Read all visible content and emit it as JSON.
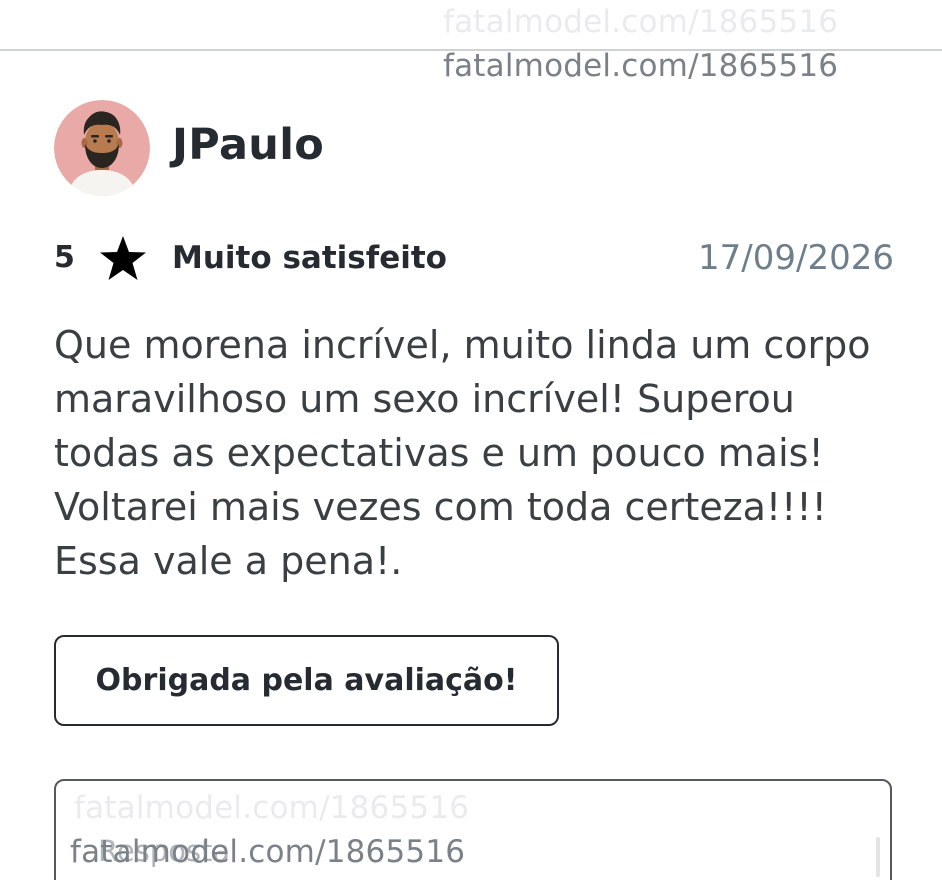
{
  "watermark": {
    "text": "fatalmodel.com/1865516"
  },
  "review": {
    "reviewer_name": "JPaulo",
    "avatar_icon": "bearded-man-avatar-icon",
    "rating": "5",
    "rating_icon": "star-icon",
    "rating_label": "Muito satisfeito",
    "date": "17/09/2026",
    "text": "Que morena incrível, muito linda um corpo maravilhoso um sexo incrível! Superou todas as expectativas e um pouco mais! Voltarei mais vezes com toda certeza!!!! Essa vale a pena!."
  },
  "actions": {
    "thank_button_label": "Obrigada pela avaliação!",
    "reply_placeholder": "Resposta"
  },
  "colors": {
    "text_primary": "#262b31",
    "date_color": "#6e7f8c",
    "avatar_background": "#e8a9a7"
  }
}
